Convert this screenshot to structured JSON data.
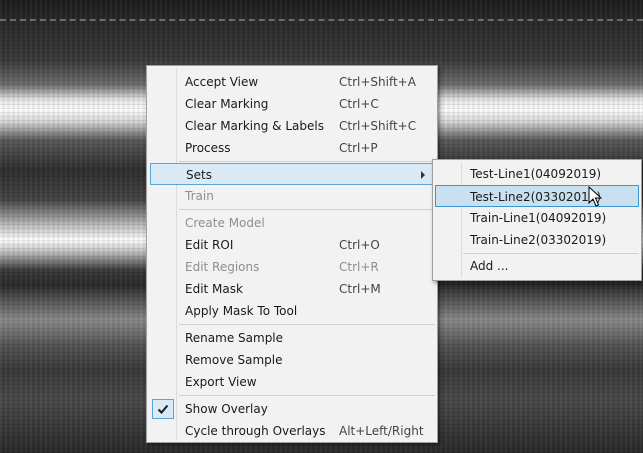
{
  "context_menu": {
    "items": [
      {
        "label": "Accept View",
        "shortcut": "Ctrl+Shift+A"
      },
      {
        "label": "Clear Marking",
        "shortcut": "Ctrl+C"
      },
      {
        "label": "Clear Marking & Labels",
        "shortcut": "Ctrl+Shift+C"
      },
      {
        "label": "Process",
        "shortcut": "Ctrl+P"
      },
      {
        "label": "Sets",
        "shortcut": ""
      },
      {
        "label": "Train",
        "shortcut": ""
      },
      {
        "label": "Create Model",
        "shortcut": ""
      },
      {
        "label": "Edit ROI",
        "shortcut": "Ctrl+O"
      },
      {
        "label": "Edit Regions",
        "shortcut": "Ctrl+R"
      },
      {
        "label": "Edit Mask",
        "shortcut": "Ctrl+M"
      },
      {
        "label": "Apply Mask To Tool",
        "shortcut": ""
      },
      {
        "label": "Rename Sample",
        "shortcut": ""
      },
      {
        "label": "Remove Sample",
        "shortcut": ""
      },
      {
        "label": "Export View",
        "shortcut": ""
      },
      {
        "label": "Show Overlay",
        "shortcut": "",
        "checked": true
      },
      {
        "label": "Cycle through Overlays",
        "shortcut": "Alt+Left/Right"
      }
    ]
  },
  "sets_submenu": {
    "items": [
      {
        "label": "Test-Line1(04092019)"
      },
      {
        "label": "Test-Line2(03302019)"
      },
      {
        "label": "Train-Line1(04092019)"
      },
      {
        "label": "Train-Line2(03302019)"
      },
      {
        "label": "Add ..."
      }
    ]
  },
  "colors": {
    "highlight_bg": "#d9e9f5",
    "highlight_border": "#5aa4d6",
    "menu_bg": "#f2f2f2",
    "disabled_text": "#8e8e8e"
  }
}
